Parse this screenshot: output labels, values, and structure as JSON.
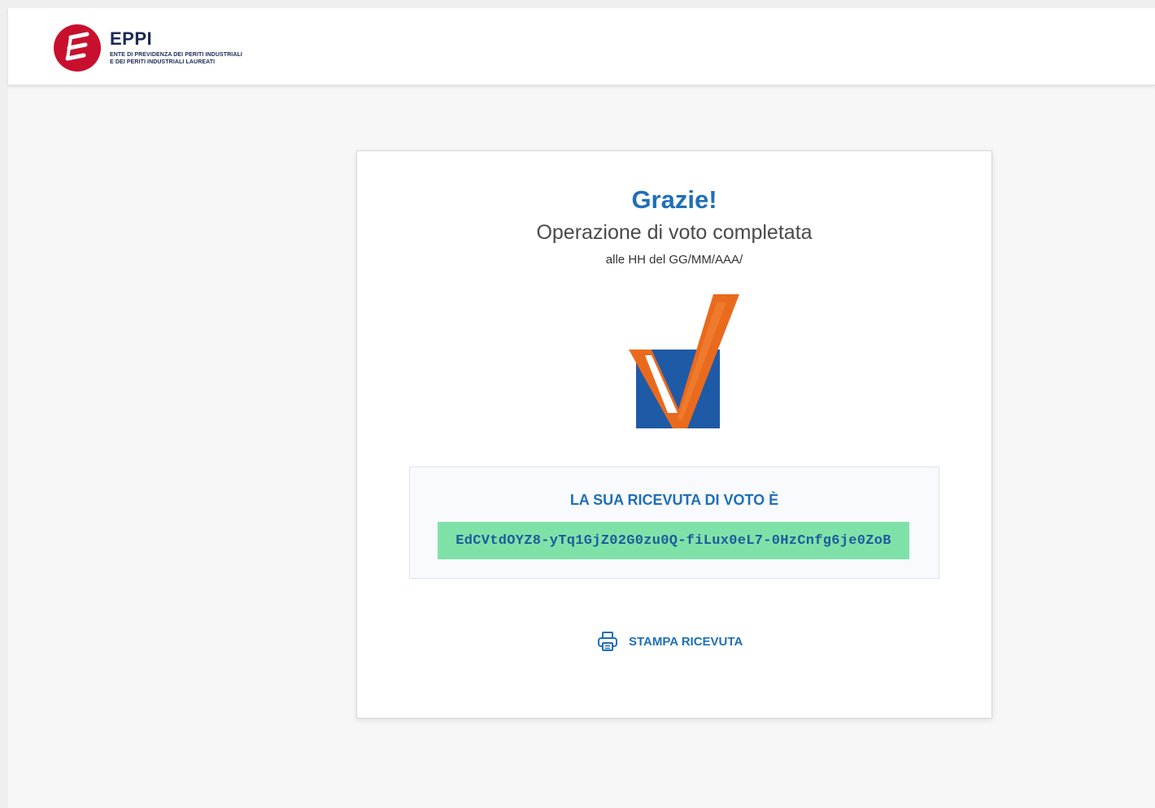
{
  "header": {
    "logo_name": "EPPI",
    "logo_subtitle_line1": "ENTE DI PREVIDENZA DEI PERITI INDUSTRIALI",
    "logo_subtitle_line2": "E DEI PERITI INDUSTRIALI LAUREATI"
  },
  "confirmation": {
    "title": "Grazie!",
    "subtitle": "Operazione di voto completata",
    "timestamp_text": "alle HH del GG/MM/AAA/"
  },
  "receipt": {
    "label": "LA SUA RICEVUTA DI VOTO È",
    "code": "EdCVtdOYZ8-yTq1GjZ02G0zu0Q-fiLux0eL7-0HzCnfg6je0ZoB"
  },
  "actions": {
    "print_label": "STAMPA RICEVUTA"
  },
  "colors": {
    "brand_red": "#c8102e",
    "primary_blue": "#1f6fb7",
    "vote_blue": "#1f5aa6",
    "vote_orange": "#ea6a1d",
    "receipt_green": "#7ee2a8"
  },
  "icons": {
    "logo": "eppi-logo-icon",
    "vote": "vote-checkmark-icon",
    "print": "printer-icon"
  }
}
